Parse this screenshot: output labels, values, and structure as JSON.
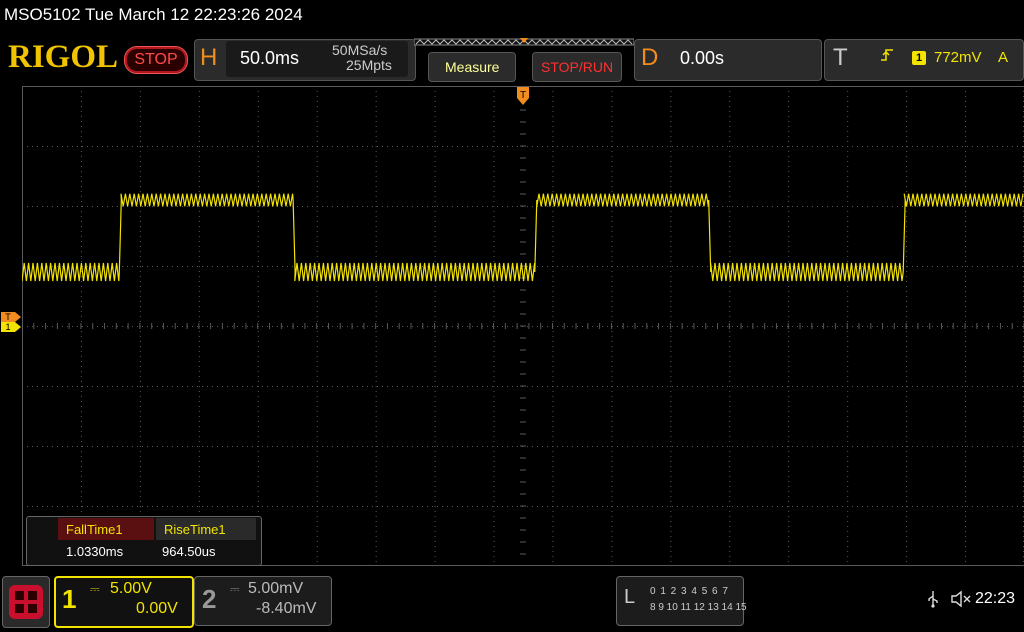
{
  "title_bar": {
    "text": "MSO5102  Tue March 12 22:23:26 2024"
  },
  "brand": {
    "logo": "RIGOL",
    "run_state": "STOP"
  },
  "horizontal": {
    "letter": "H",
    "timebase": "50.0ms",
    "sample_rate": "50MSa/s",
    "memory_depth": "25Mpts"
  },
  "buttons": {
    "measure": "Measure",
    "stop_run": "STOP/RUN"
  },
  "delay": {
    "letter": "D",
    "value": "0.00s"
  },
  "trigger": {
    "letter": "T",
    "edge_icon": "rising-edge-icon",
    "source": "1",
    "level": "772mV",
    "mode": "A"
  },
  "markers": {
    "trigger_position": "T",
    "trigger_level": "T",
    "channel1_ground": "1"
  },
  "measurements": {
    "headers": [
      "FallTime1",
      "RiseTime1"
    ],
    "values": [
      "1.0330ms",
      "964.50us"
    ]
  },
  "channels": [
    {
      "number": "1",
      "coupling": "⎓",
      "scale": "5.00V",
      "offset": "0.00V",
      "color": "#f2e300",
      "active": true
    },
    {
      "number": "2",
      "coupling": "⎓",
      "scale": "5.00mV",
      "offset": "-8.40mV",
      "color": "#999999",
      "active": false
    }
  ],
  "logic_analyzer": {
    "letter": "L",
    "row1": "0 1 2 3  4 5 6 7",
    "row2": "8 9 10 11 12 13 14 15"
  },
  "status": {
    "usb_icon": "usb-icon",
    "mute_icon": "speaker-mute-icon",
    "clock": "22:23"
  },
  "waveform": {
    "channel": "1",
    "description_units": "divisions",
    "low_level_div": 0.9,
    "high_level_div": 2.1,
    "ripple_div": 0.15,
    "transitions_div": [
      1.65,
      4.6,
      8.7,
      11.65,
      14.95
    ],
    "start_state": "low",
    "h_divisions": 17,
    "v_divisions": 8
  },
  "colors": {
    "trace": "#f2e300",
    "grid": "#5a5a5a",
    "accent": "#f28c1f"
  }
}
